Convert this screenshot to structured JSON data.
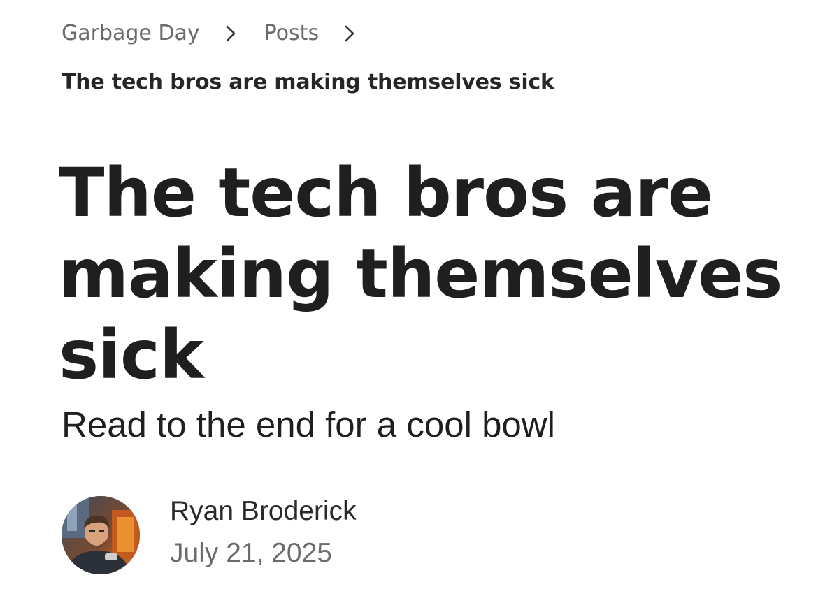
{
  "breadcrumb": {
    "items": [
      {
        "label": "Garbage Day"
      },
      {
        "label": "Posts"
      }
    ],
    "current": "The tech bros are making themselves sick"
  },
  "icons": {
    "separator": "chevron-right-icon"
  },
  "article": {
    "title": "The tech bros are making themselves sick",
    "subtitle": "Read to the end for a cool bowl"
  },
  "author": {
    "name": "Ryan Broderick",
    "date": "July 21, 2025"
  },
  "colors": {
    "text_primary": "#1f1f1f",
    "text_muted": "#6b6b6b",
    "background": "#ffffff"
  }
}
